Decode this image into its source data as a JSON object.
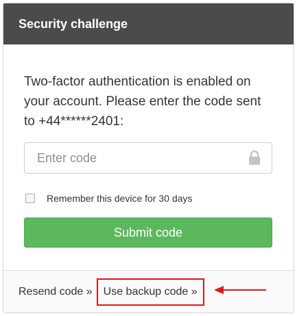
{
  "header": {
    "title": "Security challenge"
  },
  "main": {
    "message": "Two-factor authentication is enabled on your account. Please enter the code sent to +44******2401:",
    "code_input": {
      "placeholder": "Enter code",
      "value": "",
      "icon": "lock-icon"
    },
    "remember": {
      "label": "Remember this device for 30 days",
      "checked": false
    },
    "submit_label": "Submit code"
  },
  "footer": {
    "resend_label": "Resend code »",
    "backup_label": "Use backup code »"
  },
  "colors": {
    "header_bg": "#4b4b4b",
    "submit_bg": "#5cb85c",
    "annotation": "#e0161b"
  }
}
